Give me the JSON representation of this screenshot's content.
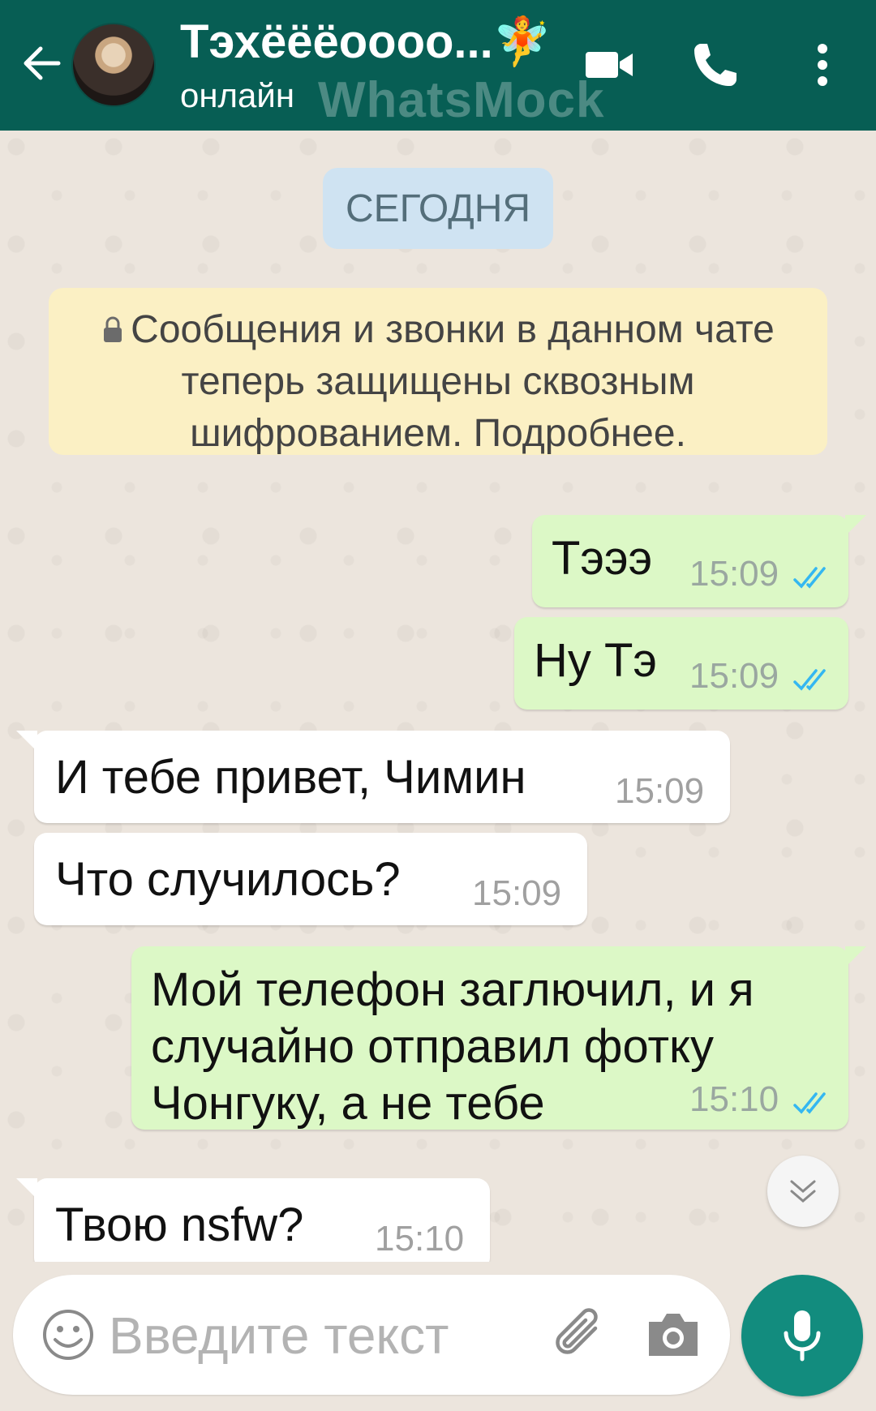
{
  "header": {
    "contact_name": "Тэхёёёоооо...🧚",
    "status": "онлайн",
    "watermark": "WhatsMock"
  },
  "icons": {
    "back": "arrow-left-icon",
    "video": "video-camera-icon",
    "phone": "phone-icon",
    "more": "more-vert-icon",
    "lock": "lock-icon",
    "emoji": "emoji-icon",
    "attach": "paperclip-icon",
    "camera": "camera-icon",
    "mic": "mic-icon",
    "scroll": "double-chevron-down-icon",
    "read": "double-check-icon"
  },
  "colors": {
    "header": "#075e54",
    "outgoing_bubble": "#dcf8c6",
    "incoming_bubble": "#ffffff",
    "read_ticks": "#34b7f1",
    "mic_button": "#128c7e",
    "date_chip": "#cfe3f2",
    "notice": "#fbf0c4"
  },
  "chat": {
    "date_label": "СЕГОДНЯ",
    "encryption_notice": "Сообщения и звонки в данном чате теперь защищены сквозным шифрованием. Подробнее.",
    "messages": [
      {
        "direction": "out",
        "text": "Тэээ",
        "time": "15:09",
        "read": true
      },
      {
        "direction": "out",
        "text": "Ну Тэ",
        "time": "15:09",
        "read": true
      },
      {
        "direction": "in",
        "text": "И тебе привет, Чимин",
        "time": "15:09"
      },
      {
        "direction": "in",
        "text": "Что случилось?",
        "time": "15:09"
      },
      {
        "direction": "out",
        "lines": [
          "Мой телефон заглючил, и я",
          "случайно отправил фотку",
          "Чонгуку, а не тебе"
        ],
        "time": "15:10",
        "read": true
      },
      {
        "direction": "in",
        "text": "Твою nsfw?",
        "time": "15:10"
      }
    ]
  },
  "input": {
    "placeholder": "Введите текст"
  }
}
